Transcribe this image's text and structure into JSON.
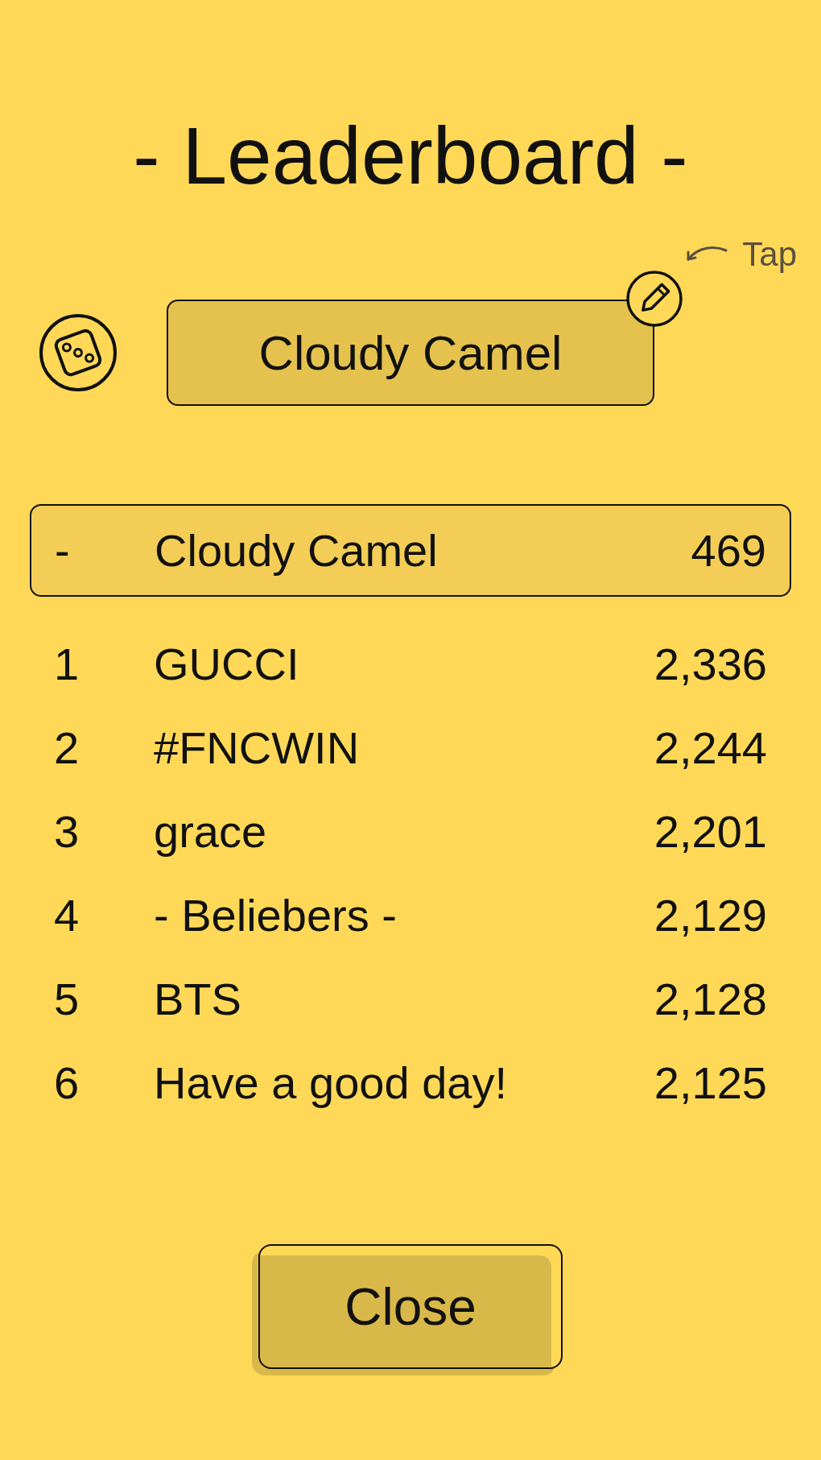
{
  "title": "- Leaderboard -",
  "hint": {
    "text": "Tap"
  },
  "player": {
    "name": "Cloudy Camel"
  },
  "current_entry": {
    "rank": "-",
    "name": "Cloudy Camel",
    "score": "469"
  },
  "entries": [
    {
      "rank": "1",
      "name": "GUCCI",
      "score": "2,336"
    },
    {
      "rank": "2",
      "name": "#FNCWIN",
      "score": "2,244"
    },
    {
      "rank": "3",
      "name": "grace",
      "score": "2,201"
    },
    {
      "rank": "4",
      "name": "- Beliebers -",
      "score": "2,129"
    },
    {
      "rank": "5",
      "name": "BTS",
      "score": "2,128"
    },
    {
      "rank": "6",
      "name": "Have a good day!",
      "score": "2,125"
    }
  ],
  "close_button": {
    "label": "Close"
  }
}
